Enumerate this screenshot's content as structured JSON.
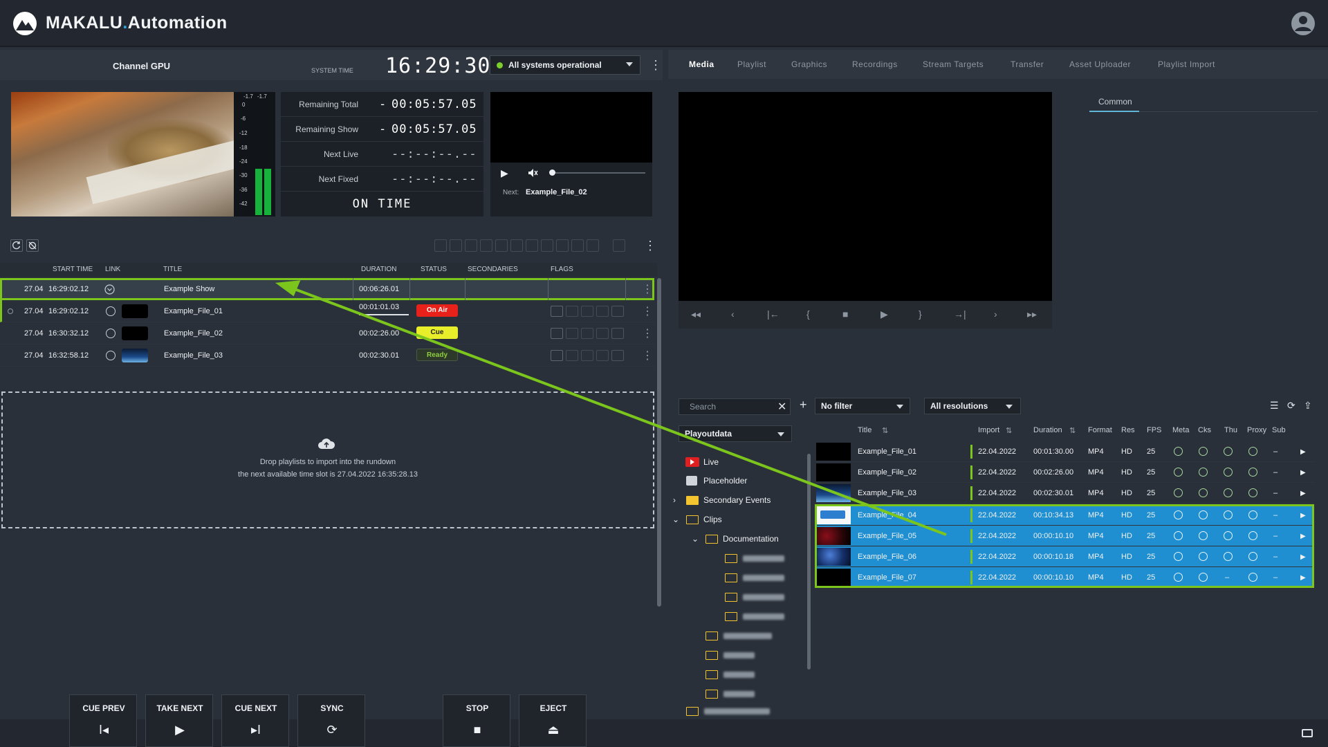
{
  "app": {
    "title": "MAKALU.Automation",
    "title_main": "MAKALU",
    "title_dot": ".",
    "title_suffix": "Automation"
  },
  "channel": {
    "name": "Channel GPU",
    "system_time_label": "SYSTEM TIME",
    "system_time": "16:29:30",
    "status": "All systems operational",
    "status_color": "#7ccf2a"
  },
  "meter": {
    "peak_left": "-1.7",
    "peak_right": "-1.7",
    "scale": [
      "0",
      "-6",
      "-12",
      "-18",
      "-24",
      "-30",
      "-36",
      "-42"
    ],
    "level_left": 0.38,
    "level_right": 0.38
  },
  "timing": {
    "rows": [
      {
        "label": "Remaining Total",
        "sign": "-",
        "value": "00:05:57.05"
      },
      {
        "label": "Remaining Show",
        "sign": "-",
        "value": "00:05:57.05"
      },
      {
        "label": "Next Live",
        "sign": "",
        "value": "--:--:--.--"
      },
      {
        "label": "Next Fixed",
        "sign": "",
        "value": "--:--:--.--"
      }
    ],
    "on_time": "ON TIME"
  },
  "next_preview": {
    "label": "Next:",
    "value": "Example_File_02"
  },
  "playlist": {
    "columns": {
      "start": "START TIME",
      "link": "LINK",
      "title": "TITLE",
      "duration": "DURATION",
      "status": "STATUS",
      "secondaries": "SECONDARIES",
      "flags": "FLAGS"
    },
    "rows": [
      {
        "date": "27.04",
        "time": "16:29:02.12",
        "title": "Example Show",
        "duration": "00:06:26.01",
        "status": "",
        "type": "show"
      },
      {
        "date": "27.04",
        "time": "16:29:02.12",
        "title": "Example_File_01",
        "duration": "00:01:01.03",
        "status": "On Air",
        "status_bg": "#e8221b",
        "status_fg": "#ffffff"
      },
      {
        "date": "27.04",
        "time": "16:30:32.12",
        "title": "Example_File_02",
        "duration": "00:02:26.00",
        "status": "Cue",
        "status_bg": "#e8ee2a",
        "status_fg": "#222222"
      },
      {
        "date": "27.04",
        "time": "16:32:58.12",
        "title": "Example_File_03",
        "duration": "00:02:30.01",
        "status": "Ready",
        "status_bg": "#2d3a2a",
        "status_fg": "#8fcf3c"
      }
    ],
    "drop_line1": "Drop playlists to import into the rundown",
    "drop_line2": "the next available time slot is 27.04.2022 16:35:28.13"
  },
  "controls": [
    {
      "label": "CUE PREV",
      "icon": "skip-previous-icon",
      "glyph": "I◂"
    },
    {
      "label": "TAKE NEXT",
      "icon": "play-icon",
      "glyph": "▶"
    },
    {
      "label": "CUE NEXT",
      "icon": "skip-next-icon",
      "glyph": "▸I"
    },
    {
      "label": "SYNC",
      "icon": "sync-icon",
      "glyph": "⟳"
    },
    {
      "label": "STOP",
      "icon": "stop-icon",
      "glyph": "■"
    },
    {
      "label": "EJECT",
      "icon": "eject-icon",
      "glyph": "⏏"
    }
  ],
  "tabs": [
    "Media",
    "Playlist",
    "Graphics",
    "Recordings",
    "Stream Targets",
    "Transfer",
    "Asset Uploader",
    "Playlist Import"
  ],
  "common_tab": "Common",
  "browser": {
    "search_placeholder": "Search",
    "filter": "No filter",
    "resolution": "All resolutions",
    "source": "Playoutdata",
    "tree": [
      {
        "label": "Live"
      },
      {
        "label": "Placeholder"
      },
      {
        "label": "Secondary Events"
      },
      {
        "label": "Clips"
      },
      {
        "label": "Documentation"
      }
    ],
    "columns": {
      "title": "Title",
      "import": "Import",
      "duration": "Duration",
      "format": "Format",
      "res": "Res",
      "fps": "FPS",
      "meta": "Meta",
      "cks": "Cks",
      "thu": "Thu",
      "proxy": "Proxy",
      "sub": "Sub"
    },
    "rows": [
      {
        "title": "Example_File_01",
        "import": "22.04.2022",
        "duration": "00:01:30.00",
        "format": "MP4",
        "res": "HD",
        "fps": "25",
        "thu": "check",
        "sub": "–",
        "selected": false
      },
      {
        "title": "Example_File_02",
        "import": "22.04.2022",
        "duration": "00:02:26.00",
        "format": "MP4",
        "res": "HD",
        "fps": "25",
        "thu": "check",
        "sub": "–",
        "selected": false
      },
      {
        "title": "Example_File_03",
        "import": "22.04.2022",
        "duration": "00:02:30.01",
        "format": "MP4",
        "res": "HD",
        "fps": "25",
        "thu": "check",
        "sub": "–",
        "selected": false
      },
      {
        "title": "Example_File_04",
        "import": "22.04.2022",
        "duration": "00:10:34.13",
        "format": "MP4",
        "res": "HD",
        "fps": "25",
        "thu": "check",
        "sub": "–",
        "selected": true
      },
      {
        "title": "Example_File_05",
        "import": "22.04.2022",
        "duration": "00:00:10.10",
        "format": "MP4",
        "res": "HD",
        "fps": "25",
        "thu": "check",
        "sub": "–",
        "selected": true
      },
      {
        "title": "Example_File_06",
        "import": "22.04.2022",
        "duration": "00:00:10.18",
        "format": "MP4",
        "res": "HD",
        "fps": "25",
        "thu": "check",
        "sub": "–",
        "selected": true
      },
      {
        "title": "Example_File_07",
        "import": "22.04.2022",
        "duration": "00:00:10.10",
        "format": "MP4",
        "res": "HD",
        "fps": "25",
        "thu": "–",
        "sub": "–",
        "selected": true
      }
    ]
  },
  "colors": {
    "accent_green": "#7cc51c",
    "selection_blue": "#1f8fd1",
    "on_air": "#e8221b",
    "cue": "#e8ee2a"
  }
}
